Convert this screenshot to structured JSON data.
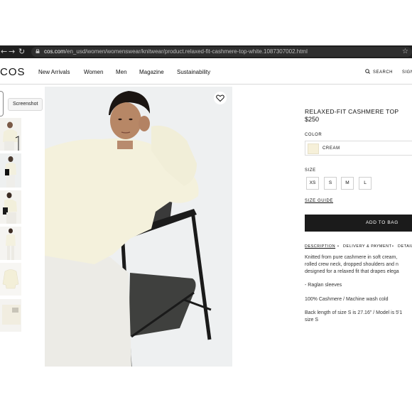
{
  "browser": {
    "url_domain": "cos.com",
    "url_path": "/en_usd/women/womenswear/knitwear/product.relaxed-fit-cashmere-top-white.1087307002.html",
    "back_icon": "arrow-left-icon",
    "forward_icon": "arrow-right-icon",
    "reload_icon": "reload-icon",
    "bookmark_icon": "star-icon"
  },
  "header": {
    "logo": "COS",
    "nav": [
      "New Arrivals",
      "Women",
      "Men",
      "Magazine",
      "Sustainability"
    ],
    "search_label": "SEARCH",
    "signin_label": "SIGN"
  },
  "gallery": {
    "tooltip": "Screenshot",
    "thumbnail_count": 6
  },
  "product": {
    "title": "RELAXED-FIT CASHMERE TOP",
    "price": "$250",
    "color_label": "COLOR",
    "color_value": "CREAM",
    "size_label": "SIZE",
    "sizes": [
      "XS",
      "S",
      "M",
      "L"
    ],
    "size_guide": "SIZE GUIDE",
    "add_to_bag": "ADD TO BAG",
    "tabs": [
      "DESCRIPTION",
      "DELIVERY & PAYMENT",
      "DETAIL"
    ],
    "tab_separator": "•",
    "description_lines": [
      "Knitted from pure cashmere in soft cream,",
      "rolled crew neck, dropped shoulders and n",
      "designed for a relaxed fit that drapes elega"
    ],
    "feature": "- Raglan sleeves",
    "composition": "100% Cashmere / Machine wash cold",
    "fit_note_lines": [
      "Back length of size S is 27.16\" / Model is 5'1",
      "size S"
    ]
  },
  "colors": {
    "chrome": "#1f1f1f",
    "button": "#1b1b1b",
    "swatch": "#f6f0d9"
  }
}
